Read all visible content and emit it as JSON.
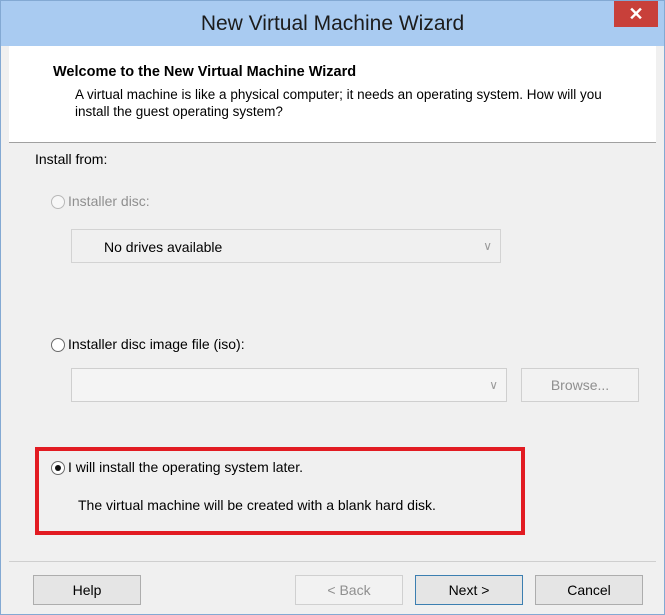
{
  "window": {
    "title": "New Virtual Machine Wizard",
    "close_label": "✕"
  },
  "header": {
    "title": "Welcome to the New Virtual Machine Wizard",
    "description": "A virtual machine is like a physical computer; it needs an operating system. How will you install the guest operating system?"
  },
  "install": {
    "label": "Install from:",
    "installer_disc": {
      "label": "Installer disc:",
      "enabled": false,
      "selected": false,
      "drive_value": "No drives available"
    },
    "iso": {
      "label": "Installer disc image file (iso):",
      "enabled": true,
      "selected": false,
      "path_value": "",
      "browse_label": "Browse..."
    },
    "later": {
      "label": "I will install the operating system later.",
      "selected": true,
      "description": "The virtual machine will be created with a blank hard disk."
    }
  },
  "footer": {
    "help": "Help",
    "back": "< Back",
    "next": "Next >",
    "cancel": "Cancel"
  },
  "colors": {
    "highlight": "#e21b22",
    "titlebar": "#a9cbf1",
    "close": "#c8403a"
  }
}
